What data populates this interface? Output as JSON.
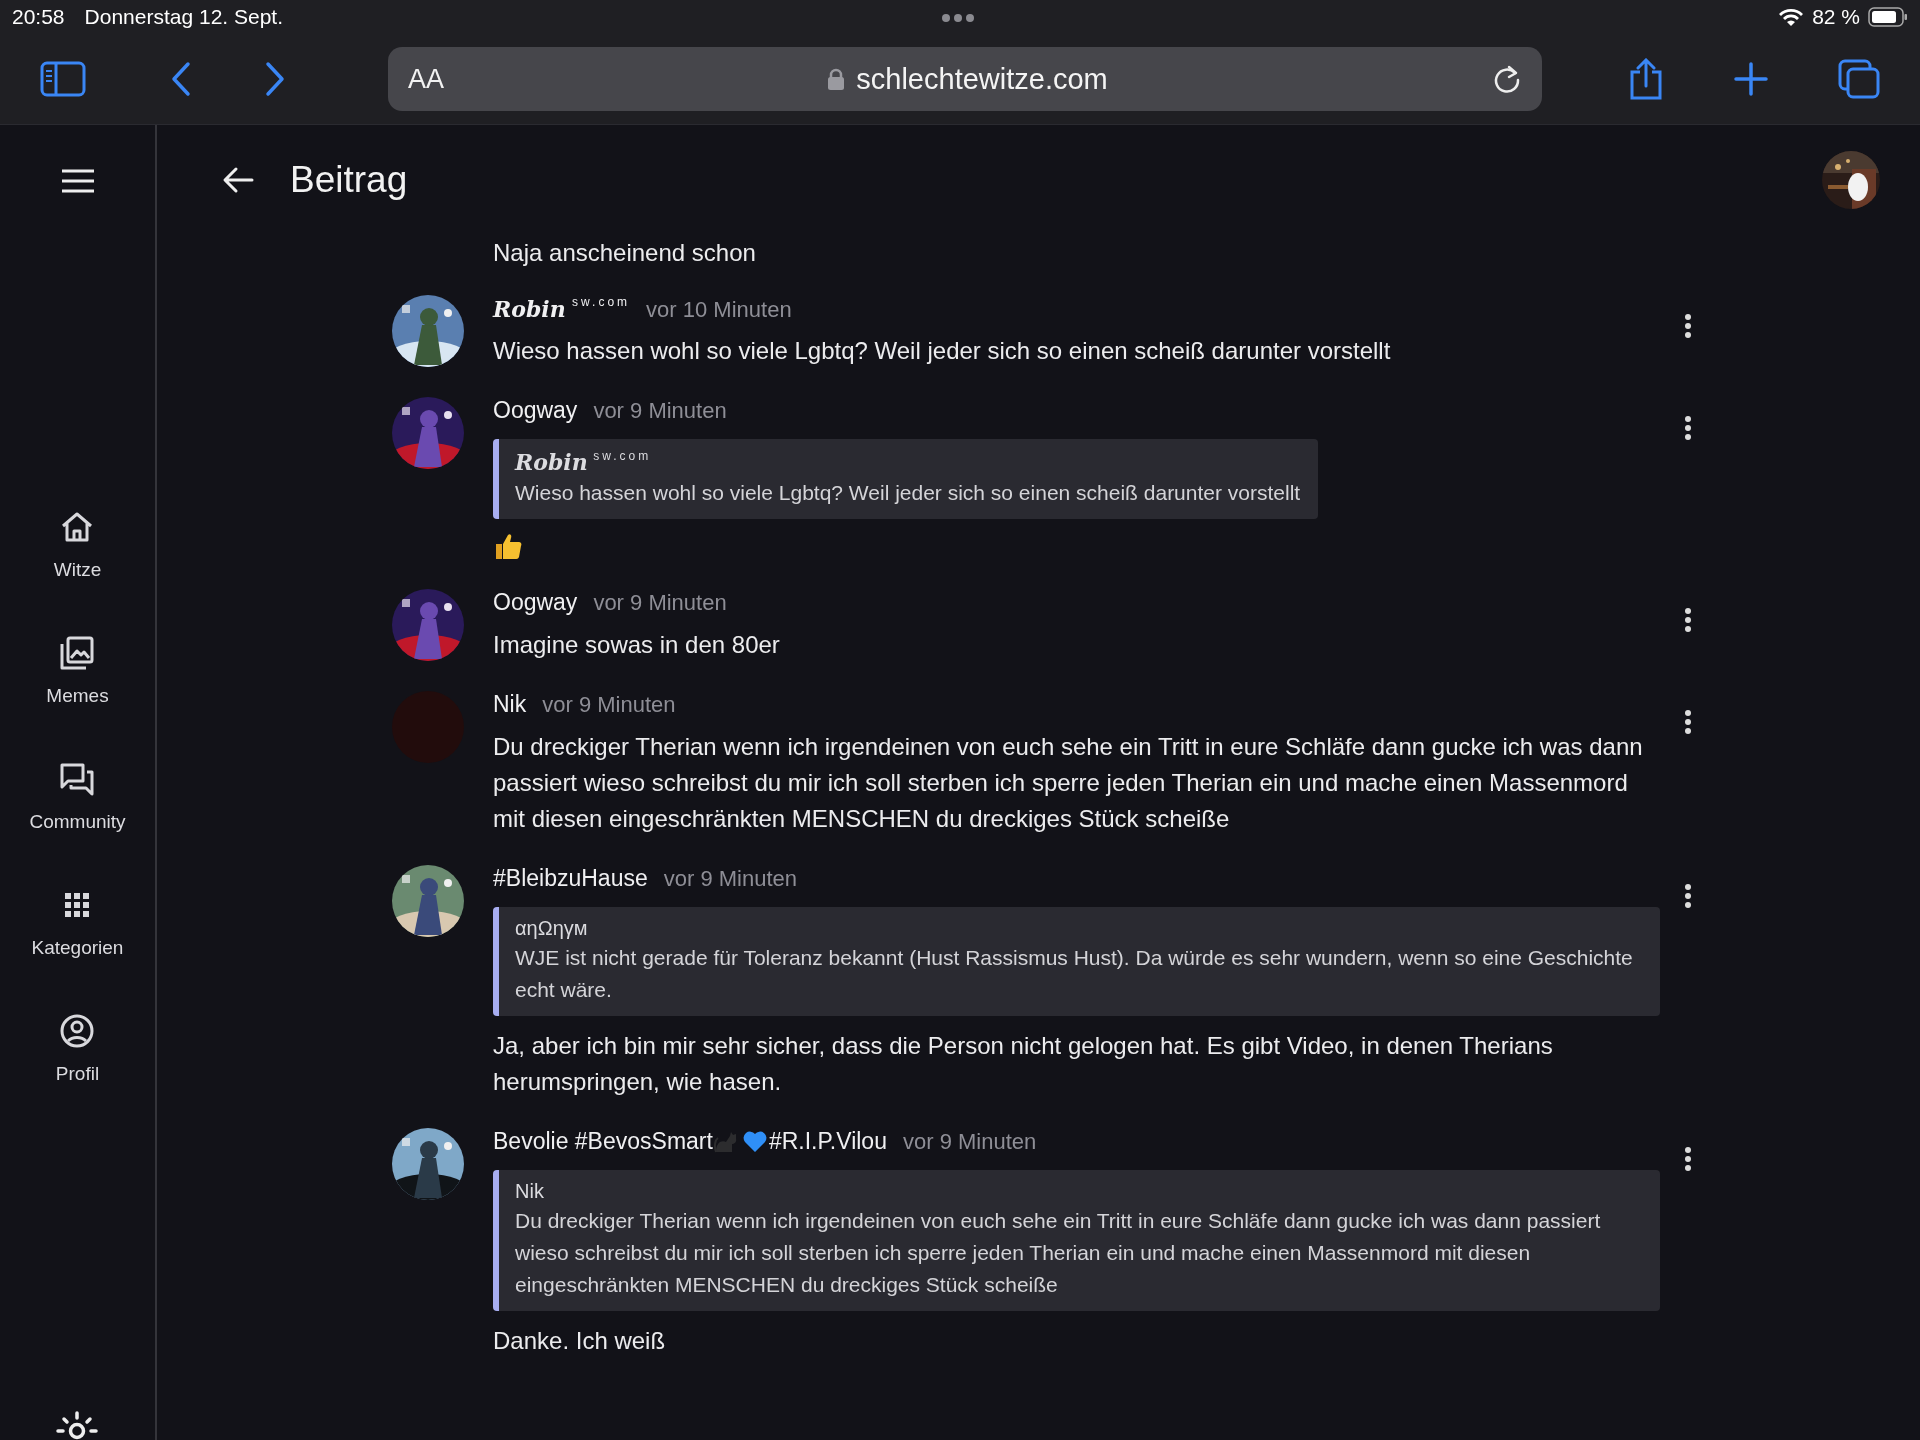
{
  "status_bar": {
    "time": "20:58",
    "date": "Donnerstag 12. Sept.",
    "battery": "82 %"
  },
  "browser": {
    "text_size": "AA",
    "url": "schlechtewitze.com"
  },
  "sidebar": {
    "items": [
      {
        "label": "Witze"
      },
      {
        "label": "Memes"
      },
      {
        "label": "Community"
      },
      {
        "label": "Kategorien"
      },
      {
        "label": "Profil"
      }
    ]
  },
  "header": {
    "title": "Beitrag"
  },
  "intro_text": "Naja anscheinend schon",
  "comments": [
    {
      "author": [
        {
          "kind": "script",
          "text": "Robin",
          "tag": "sw.com"
        }
      ],
      "time": "vor 10 Minuten",
      "avatar": {
        "kind": "picture"
      },
      "text": "Wieso hassen wohl so viele Lgbtq? Weil jeder sich so einen scheiß darunter vorstellt"
    },
    {
      "author": [
        {
          "kind": "text",
          "text": "Oogway"
        }
      ],
      "time": "vor 9 Minuten",
      "avatar": {
        "kind": "picture"
      },
      "quote": {
        "author": [
          {
            "kind": "script",
            "text": "Robin",
            "tag": "sw.com"
          }
        ],
        "text": "Wieso hassen wohl so viele Lgbtq? Weil jeder sich so einen scheiß darunter vorstellt"
      },
      "reaction": {
        "kind": "thumbs-up"
      }
    },
    {
      "author": [
        {
          "kind": "text",
          "text": "Oogway"
        }
      ],
      "time": "vor 9 Minuten",
      "avatar": {
        "kind": "picture"
      },
      "text": "Imagine sowas in den 80er"
    },
    {
      "author": [
        {
          "kind": "text",
          "text": "Nik"
        }
      ],
      "time": "vor 9 Minuten",
      "avatar": {
        "kind": "blank"
      },
      "text": "Du dreckiger Therian wenn ich irgendeinen von euch sehe ein Tritt in eure Schläfe dann gucke ich was dann passiert wieso schreibst du mir ich soll sterben ich sperre jeden Therian ein und mache einen Massenmord mit diesen eingeschränkten MENSCHEN du dreckiges Stück scheiße"
    },
    {
      "author": [
        {
          "kind": "text",
          "text": "#BleibzuHause"
        }
      ],
      "time": "vor 9 Minuten",
      "avatar": {
        "kind": "picture"
      },
      "quote": {
        "author": [
          {
            "kind": "text",
            "text": "αηΩηγм"
          }
        ],
        "text": "WJE ist nicht gerade für Toleranz bekannt (Hust Rassismus Hust). Da würde es sehr wundern, wenn so eine Geschichte echt wäre."
      },
      "text": "Ja, aber ich bin mir sehr sicher, dass die Person nicht gelogen hat. Es gibt Video, in denen Therians herumspringen, wie hasen."
    },
    {
      "author": [
        {
          "kind": "text",
          "text": "Bevolie #BevosSmart"
        },
        {
          "kind": "cat"
        },
        {
          "kind": "heart"
        },
        {
          "kind": "text",
          "text": "#R.I.P.Vilou"
        }
      ],
      "time": "vor 9 Minuten",
      "avatar": {
        "kind": "picture"
      },
      "quote": {
        "author": [
          {
            "kind": "text",
            "text": "Nik"
          }
        ],
        "text": "Du dreckiger Therian wenn ich irgendeinen von euch sehe ein Tritt in eure Schläfe dann gucke ich was dann passiert wieso schreibst du mir ich soll sterben ich sperre jeden Therian ein und mache einen Massenmord mit diesen eingeschränkten MENSCHEN du dreckiges Stück scheiße"
      },
      "text": "Danke. Ich weiß"
    }
  ]
}
